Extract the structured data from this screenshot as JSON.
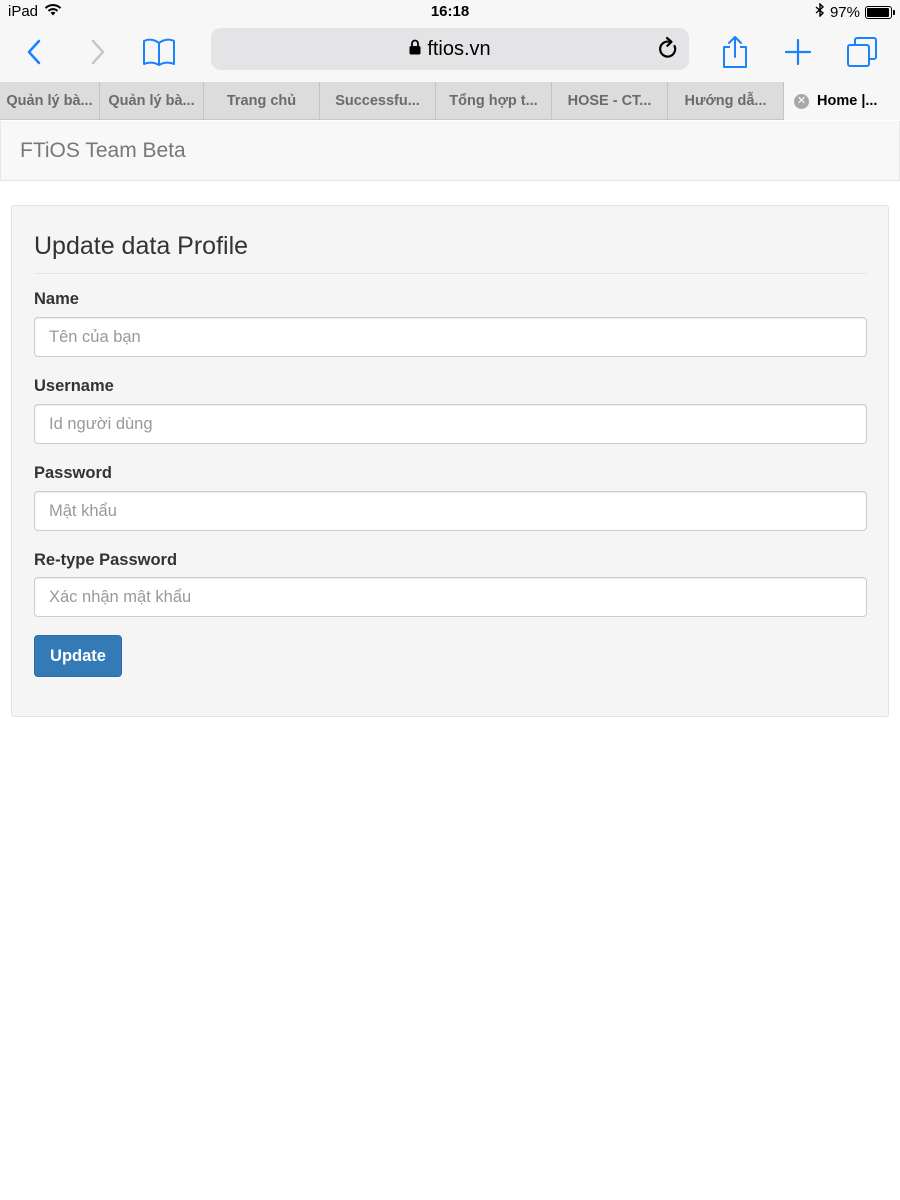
{
  "statusbar": {
    "device": "iPad",
    "time": "16:18",
    "battery_text": "97%",
    "battery_level": 0.97
  },
  "browser": {
    "url": "ftios.vn",
    "tabs": [
      {
        "label": "Quản lý bà..."
      },
      {
        "label": "Quản lý bà..."
      },
      {
        "label": "Trang chủ"
      },
      {
        "label": "Successfu..."
      },
      {
        "label": "Tổng hợp t..."
      },
      {
        "label": "HOSE - CT..."
      },
      {
        "label": "Hướng dẫ..."
      },
      {
        "label": "Home |..."
      }
    ],
    "active_tab_index": 7,
    "accent_color": "#1a82fb"
  },
  "navbar": {
    "brand": "FTiOS Team Beta"
  },
  "form": {
    "title": "Update data Profile",
    "fields": [
      {
        "label": "Name",
        "placeholder": "Tên của bạn",
        "value": ""
      },
      {
        "label": "Username",
        "placeholder": "Id người dùng",
        "value": ""
      },
      {
        "label": "Password",
        "placeholder": "Mật khẩu",
        "value": ""
      },
      {
        "label": "Re-type Password",
        "placeholder": "Xác nhận mật khẩu",
        "value": ""
      }
    ],
    "submit_label": "Update",
    "submit_color": "#337ab7"
  }
}
